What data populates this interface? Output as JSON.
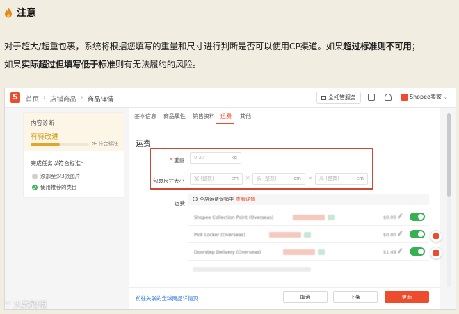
{
  "notice": {
    "title": "注意",
    "line1_a": "对于超大/超重包裹，系统将根据您填写的重量和尺寸进行判断是否可以使用CP渠道。如果",
    "line1_b": "超过标准则不可用",
    "line1_c": "；",
    "line2_a": "如果",
    "line2_b": "实际超过但填写低于标准",
    "line2_c": "则有无法履约的风险。"
  },
  "topbar": {
    "breadcrumb": [
      "首页",
      "店铺商品",
      "商品详情"
    ],
    "tuoguan_label": "全托管服务",
    "seller_label": "Shopee卖家"
  },
  "diagnosis": {
    "title": "内容诊断",
    "status": "有待改进",
    "progress": 0.5,
    "progress_label": "≫ 符合标准",
    "tasks_title": "完成任务以符合标准：",
    "tasks": [
      {
        "label": "添加至少3张图片",
        "done": false
      },
      {
        "label": "使用推荐的类目",
        "done": true
      }
    ]
  },
  "tabs": [
    "基本信息",
    "商品属性",
    "销售资料",
    "运费",
    "其他"
  ],
  "active_tab": "运费",
  "shipping": {
    "section_title": "运费",
    "weight_label": "重量",
    "weight_value": "0.27",
    "weight_unit": "kg",
    "size_label": "包裹尺寸大小",
    "width_ph": "宽 (整数)",
    "length_ph": "长 (整数)",
    "height_ph": "高 (整数)",
    "size_unit": "cm",
    "fee_label": "运费",
    "promo_text": "全店运费促销中",
    "promo_link": "查看详情",
    "channels": [
      {
        "name": "Shopee Collection Point (Overseas)",
        "price": "$0.00"
      },
      {
        "name": "Pick Locker (Overseas)",
        "price": "$0.00"
      },
      {
        "name": "Doorstep Delivery (Overseas)",
        "price": "$1.49"
      }
    ]
  },
  "footer": {
    "link": "前往关联的全球商品详情页",
    "cancel": "取消",
    "unlist": "下架",
    "update": "更新"
  },
  "watermark": "大数跨境",
  "colors": {
    "brand": "#ee4d2d",
    "toggle_on": "#35b052",
    "highlight_box": "#cc4a33"
  }
}
